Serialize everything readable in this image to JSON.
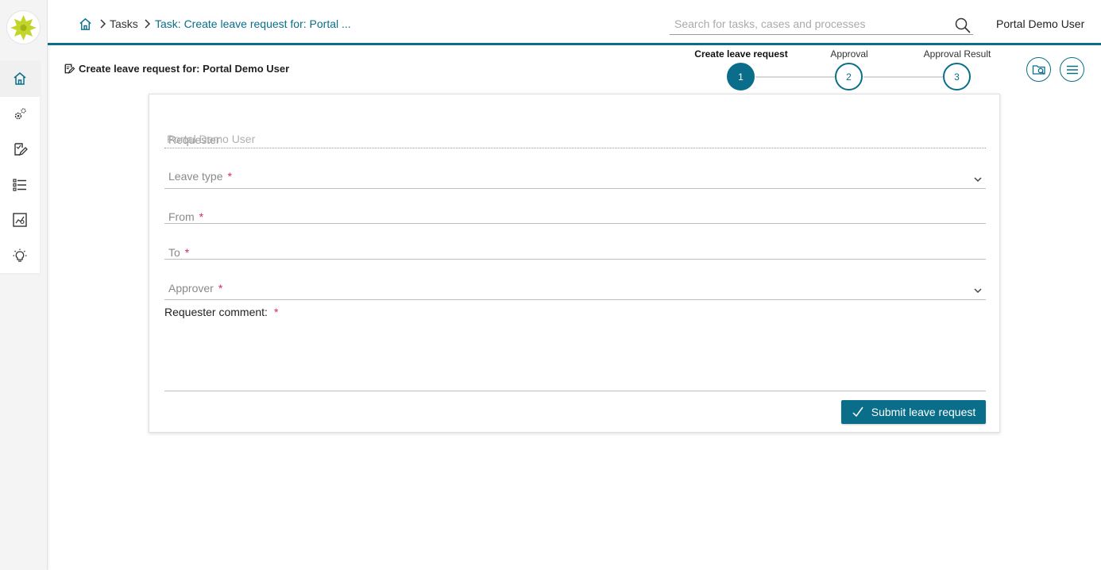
{
  "colors": {
    "accent": "#0a6e8a",
    "required": "#d6295b"
  },
  "header": {
    "breadcrumb": {
      "tasks": "Tasks",
      "task": "Task: Create leave request for: Portal ..."
    },
    "search_placeholder": "Search for tasks, cases and processes",
    "user": "Portal Demo User"
  },
  "sidebar": {
    "items": [
      {
        "icon": "home-icon"
      },
      {
        "icon": "processes-gear-icon"
      },
      {
        "icon": "tasks-icon"
      },
      {
        "icon": "cases-list-icon"
      },
      {
        "icon": "statistics-icon"
      },
      {
        "icon": "idea-bulb-icon"
      }
    ]
  },
  "page": {
    "title": "Create leave request for: Portal Demo User"
  },
  "stepper": {
    "steps": [
      {
        "label": "Create leave request",
        "number": "1"
      },
      {
        "label": "Approval",
        "number": "2"
      },
      {
        "label": "Approval Result",
        "number": "3"
      }
    ]
  },
  "form": {
    "requester": {
      "label": "Requester",
      "value": "Portal Demo User"
    },
    "leave_type": {
      "label": "Leave type",
      "required": "*"
    },
    "from": {
      "label": "From",
      "required": "*"
    },
    "to": {
      "label": "To",
      "required": "*"
    },
    "approver": {
      "label": "Approver",
      "required": "*"
    },
    "comment": {
      "label": "Requester comment:",
      "required": "*"
    },
    "submit_label": "Submit leave request"
  }
}
